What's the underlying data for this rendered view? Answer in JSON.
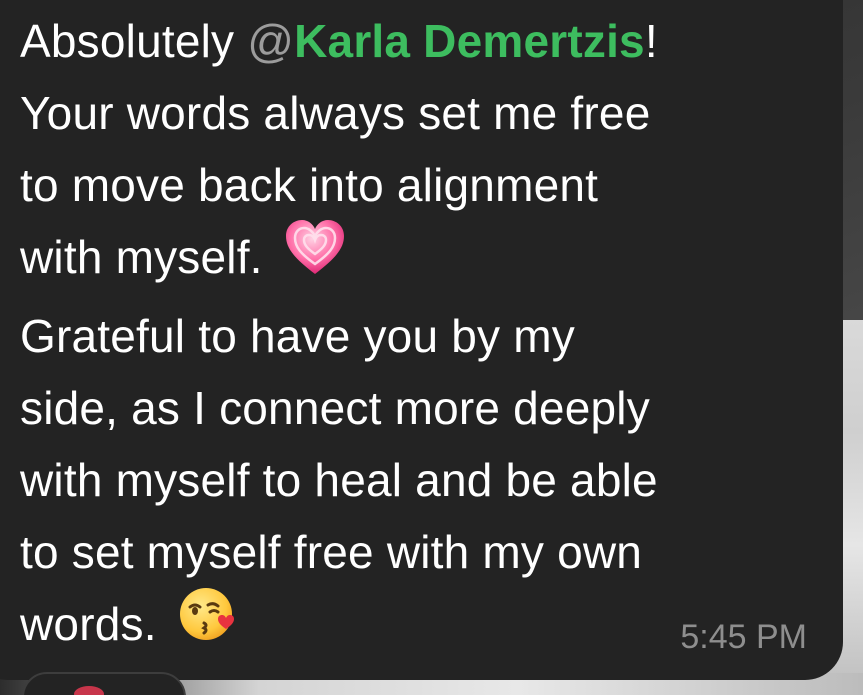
{
  "message": {
    "intro": "Absolutely",
    "mention_at": "@",
    "mention_name": "Karla Demertzis",
    "after_mention": "!",
    "line2": "Your words always set me free",
    "line3": "to move back into alignment",
    "line4": "with myself.",
    "line5": "Grateful to have you by my",
    "line6": "side, as I connect more deeply",
    "line7": "with myself to heal and be able",
    "line8": "to set myself free with my own",
    "line9": "words.",
    "emoji_1": "growing-heart-icon",
    "emoji_2": "face-blowing-kiss-icon"
  },
  "timestamp": "5:45 PM",
  "colors": {
    "bubble": "#232323",
    "text": "#ffffff",
    "mention": "#3dbd5f",
    "timestamp": "#8e8e8e"
  }
}
